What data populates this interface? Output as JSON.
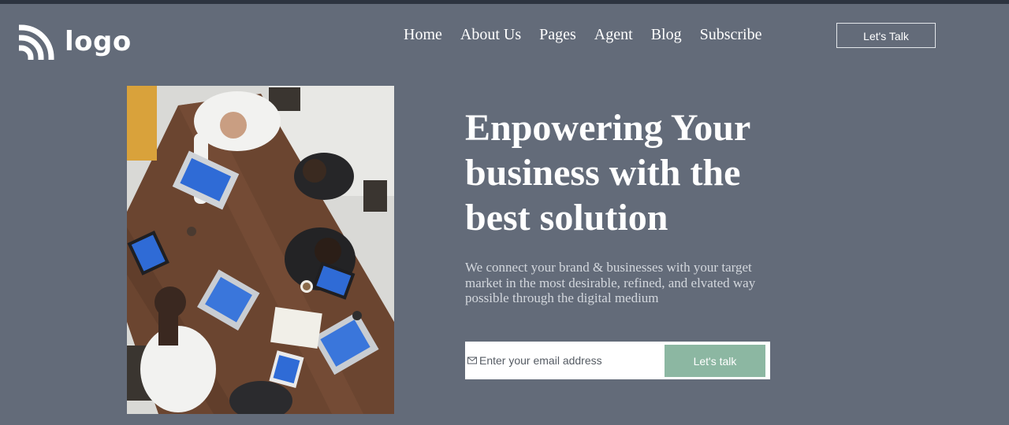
{
  "header": {
    "logo_text": "logo",
    "nav": [
      {
        "label": "Home"
      },
      {
        "label": "About Us"
      },
      {
        "label": "Pages"
      },
      {
        "label": "Agent"
      },
      {
        "label": "Blog"
      },
      {
        "label": "Subscribe"
      }
    ],
    "cta_label": "Let's Talk"
  },
  "hero": {
    "title": "Enpowering Your business with the best solution",
    "subtitle": "We connect your brand & businesses with your target market in the most desirable, refined, and elvated way possible through the digital medium",
    "image_icon": "team-meeting-photo"
  },
  "signup": {
    "email_placeholder": "Enter your email address",
    "submit_label": "Let's talk",
    "icon": "mail-icon"
  },
  "colors": {
    "background": "#636b79",
    "accent_button": "#8cb7a2",
    "heading_text": "#ffffff",
    "body_text": "#d3d7dd"
  }
}
